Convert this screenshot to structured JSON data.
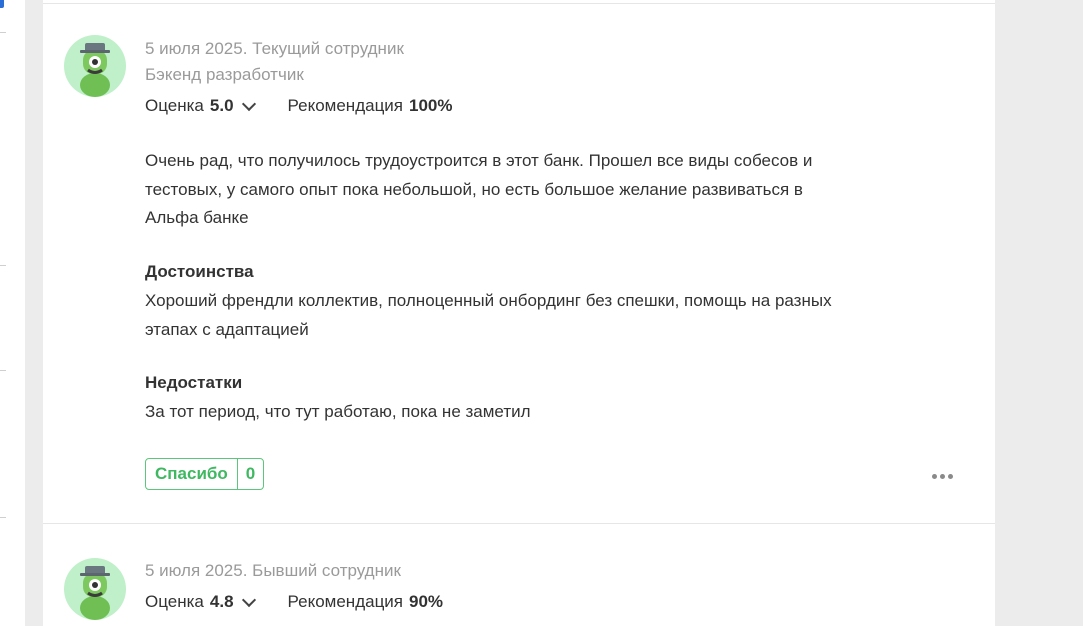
{
  "reviews": [
    {
      "meta_line": "5 июля 2025. Текущий сотрудник",
      "position": "Бэкенд разработчик",
      "rating_label": "Оценка",
      "rating_value": "5.0",
      "recommend_label": "Рекомендация",
      "recommend_value": "100%",
      "text": "Очень рад, что получилось трудоустроится в этот банк. Прошел все виды собесов и тестовых, у самого опыт пока небольшой, но есть большое желание развиваться в Альфа банке",
      "pros_title": "Достоинства",
      "pros_text": "Хороший френдли коллектив, полноценный онбординг без спешки, помощь на разных этапах с адаптацией",
      "cons_title": "Недостатки",
      "cons_text": "За тот период, что тут работаю, пока не заметил",
      "thanks_label": "Спасибо",
      "thanks_count": "0"
    },
    {
      "meta_line": "5 июля 2025. Бывший сотрудник",
      "rating_label": "Оценка",
      "rating_value": "4.8",
      "recommend_label": "Рекомендация",
      "recommend_value": "90%"
    }
  ],
  "colors": {
    "accent_green": "#3fb862",
    "avatar_bg": "#bff0c9",
    "muted_text": "#9a9a9a"
  },
  "icons": [
    "avatar-mascot-icon",
    "chevron-down-icon",
    "more-dots-icon"
  ]
}
